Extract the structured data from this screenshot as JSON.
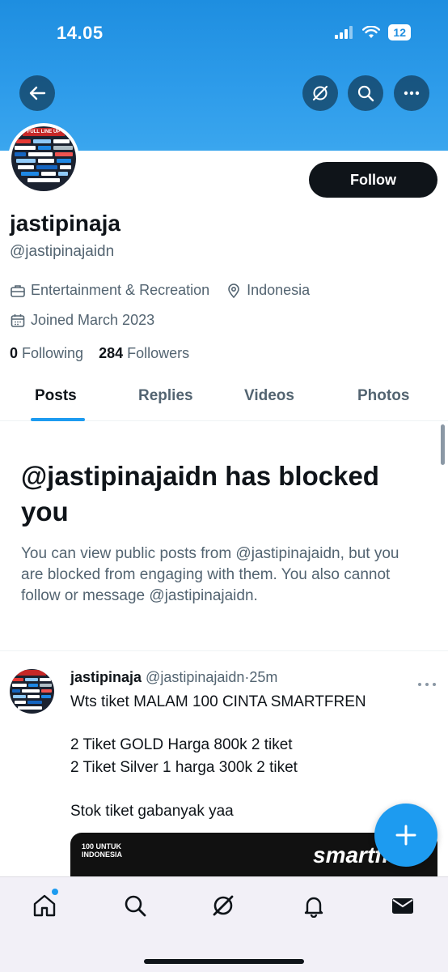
{
  "status_bar": {
    "time": "14.05",
    "battery": "12"
  },
  "header": {
    "icons": [
      "back-arrow-icon",
      "grok-icon",
      "search-icon",
      "more-icon"
    ],
    "follow_label": "Follow"
  },
  "profile": {
    "display_name": "jastipinaja",
    "handle": "@jastipinajaidn",
    "category": "Entertainment & Recreation",
    "location": "Indonesia",
    "joined": "Joined March 2023",
    "following_count": "0",
    "following_label": "Following",
    "followers_count": "284",
    "followers_label": "Followers"
  },
  "tabs": [
    {
      "label": "Posts",
      "active": true
    },
    {
      "label": "Replies",
      "active": false
    },
    {
      "label": "Videos",
      "active": false
    },
    {
      "label": "Photos",
      "active": false
    }
  ],
  "blocked_notice": {
    "title": "@jastipinajaidn has blocked you",
    "body": "You can view public posts from @jastipinajaidn, but you are blocked from engaging with them. You also cannot follow or message @jastipinajaidn."
  },
  "post": {
    "author_name": "jastipinaja",
    "author_handle": "@jastipinajaidn",
    "separator": "·",
    "time": "25m",
    "lines": [
      "Wts tiket MALAM 100 CINTA SMARTFREN",
      "",
      "2 Tiket GOLD Harga 800k 2 tiket",
      "2 Tiket Silver 1 harga 300k 2 tiket",
      "",
      "Stok tiket gabanyak yaa"
    ],
    "media_text_left": "100 UNTUK INDONESIA",
    "media_text_right": "smartfren"
  },
  "avatar_badge_text": "FULL LINE UP",
  "bottom_nav": [
    "home-icon",
    "search-icon",
    "grok-icon",
    "notifications-icon",
    "messages-icon"
  ],
  "colors": {
    "accent": "#1d9bf0",
    "banner": "#2e9cea",
    "text": "#0f1419",
    "muted": "#536471"
  }
}
